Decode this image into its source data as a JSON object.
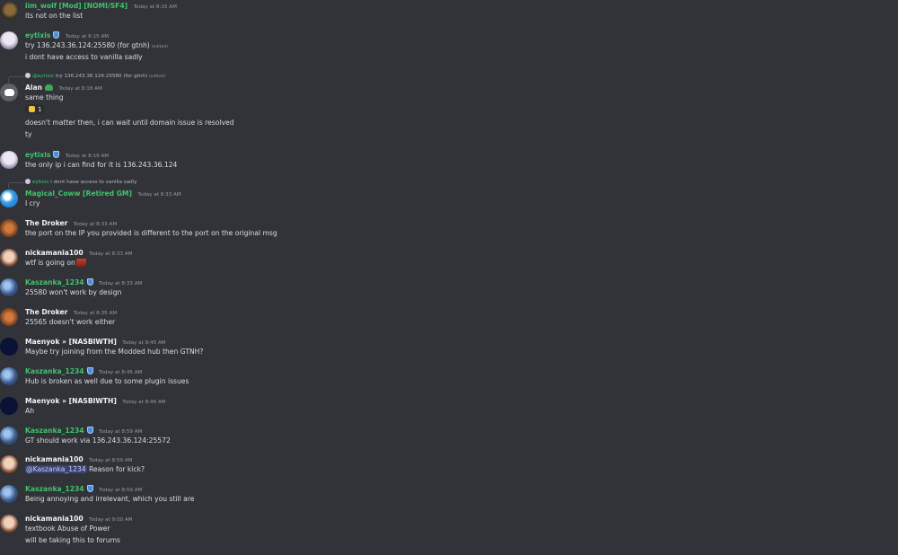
{
  "messages": [
    {
      "name": "iim_wolf",
      "role": "[Mod] [NOMI/SF4]",
      "time": "Today at 8:15 AM",
      "lines": [
        "its not on the list"
      ]
    },
    {
      "name": "eytixis",
      "time": "Today at 8:15 AM",
      "lines": [
        "try 136.243.36.124:25580 (for gtnh)",
        "i dont have access to vanilla sadly"
      ],
      "edited": "(edited)"
    },
    {
      "reply_name": "@eytixis",
      "reply_text": "try 136.243.36.124:25580 (for gtnh)",
      "reply_edited": "(edited)",
      "name": "Alan",
      "time": "Today at 8:18 AM",
      "lines": [
        "same thing",
        "doesn't matter then, i can wait until domain issue is resolved",
        "ty"
      ],
      "reaction_count": "1"
    },
    {
      "name": "eytixis",
      "time": "Today at 8:19 AM",
      "lines": [
        "the only ip i can find for it is 136.243.36.124"
      ]
    },
    {
      "reply_name": "eytixis",
      "reply_text": "i dont have access to vanilla sadly",
      "name": "Magical_Coww",
      "role": "[Retired GM]",
      "time": "Today at 8:33 AM",
      "lines": [
        "I cry"
      ]
    },
    {
      "name": "The Droker",
      "time": "Today at 8:33 AM",
      "lines": [
        "the port on the IP you provided is different to the port on the original msg"
      ]
    },
    {
      "name": "nickamania100",
      "time": "Today at 8:33 AM",
      "lines": [
        "wtf is going on"
      ]
    },
    {
      "name": "Kaszanka_1234",
      "time": "Today at 8:33 AM",
      "lines": [
        "25580 won't work by design"
      ]
    },
    {
      "name": "The Droker",
      "time": "Today at 8:35 AM",
      "lines": [
        "25565 doesn't work either"
      ]
    },
    {
      "name": "Maenyok » [NASBIWTH]",
      "time": "Today at 8:45 AM",
      "lines": [
        "Maybe try joining from the Modded hub then GTNH?"
      ]
    },
    {
      "name": "Kaszanka_1234",
      "time": "Today at 8:45 AM",
      "lines": [
        "Hub is broken as well due to some plugin issues"
      ]
    },
    {
      "name": "Maenyok » [NASBIWTH]",
      "time": "Today at 8:46 AM",
      "lines": [
        "Ah"
      ]
    },
    {
      "name": "Kaszanka_1234",
      "time": "Today at 8:59 AM",
      "lines": [
        "GT should work via 136.243.36.124:25572"
      ]
    },
    {
      "name": "nickamania100",
      "time": "Today at 8:59 AM",
      "mention": "@Kaszanka_1234",
      "lines": [
        "Reason for kick?"
      ]
    },
    {
      "name": "Kaszanka_1234",
      "time": "Today at 8:59 AM",
      "lines": [
        "Being annoying and irrelevant, which you still are"
      ]
    },
    {
      "name": "nickamania100",
      "time": "Today at 9:00 AM",
      "lines": [
        "textbook Abuse of Power",
        "will be taking this to forums"
      ]
    }
  ],
  "icons": {
    "badge": "shield-badge-icon",
    "frog": "frog-emoji-icon",
    "thumb": "thumbs-up-icon",
    "inline_emoji": "custom-emoji-icon"
  },
  "colors": {
    "background": "#313338",
    "role_green": "#3fc46b",
    "text": "#dbdee1",
    "timestamp": "#949ba4",
    "mention_bg": "#3c4270"
  }
}
